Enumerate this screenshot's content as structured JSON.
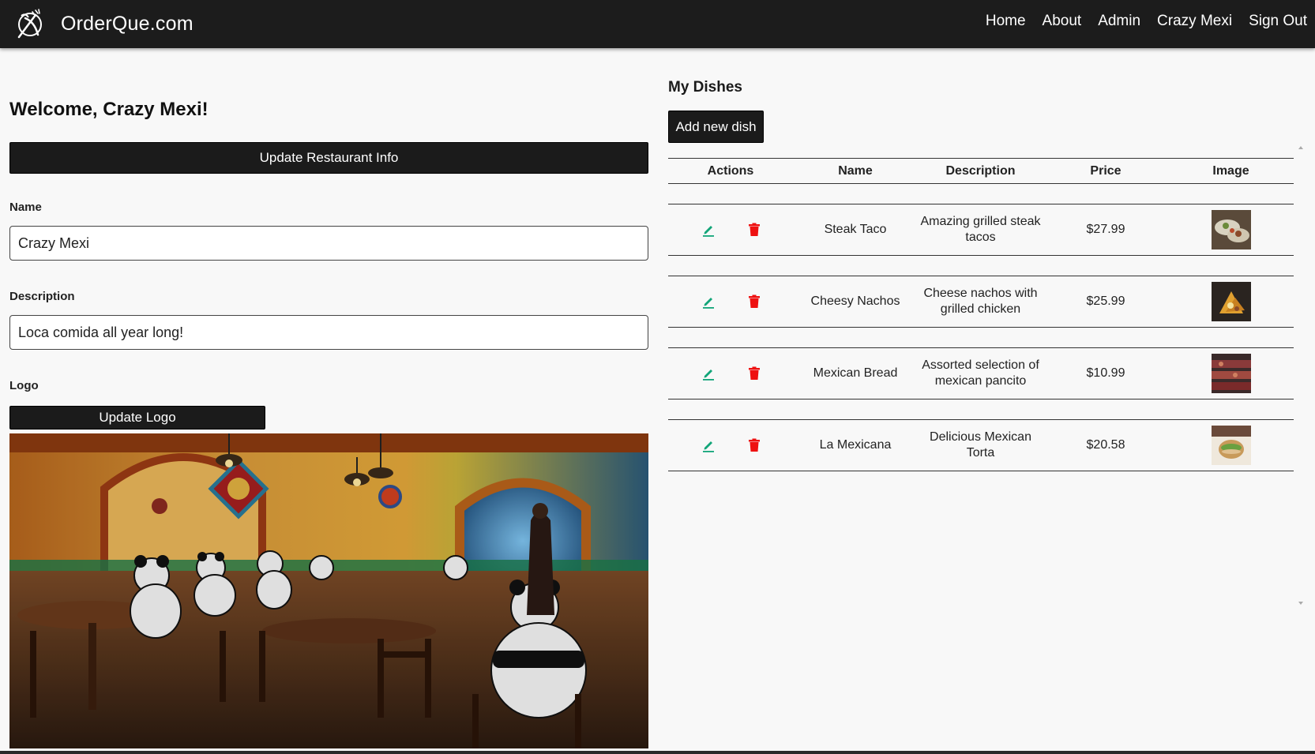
{
  "navbar": {
    "brand": "OrderQue.com",
    "links": [
      "Home",
      "About",
      "Admin",
      "Crazy Mexi",
      "Sign Out"
    ]
  },
  "left": {
    "welcome": "Welcome, Crazy Mexi!",
    "update_info_label": "Update Restaurant Info",
    "name_label": "Name",
    "name_value": "Crazy Mexi",
    "description_label": "Description",
    "description_value": "Loca comida all year long!",
    "logo_label": "Logo",
    "update_logo_label": "Update Logo"
  },
  "right": {
    "title": "My Dishes",
    "add_dish_label": "Add new dish",
    "headers": {
      "actions": "Actions",
      "name": "Name",
      "description": "Description",
      "price": "Price",
      "image": "Image"
    },
    "dishes": [
      {
        "name": "Steak Taco",
        "description": "Amazing grilled steak tacos",
        "price": "$27.99"
      },
      {
        "name": "Cheesy Nachos",
        "description": "Cheese nachos with grilled chicken",
        "price": "$25.99"
      },
      {
        "name": "Mexican Bread",
        "description": "Assorted selection of mexican pancito",
        "price": "$10.99"
      },
      {
        "name": "La Mexicana",
        "description": "Delicious Mexican Torta",
        "price": "$20.58"
      }
    ]
  },
  "icons": {
    "brand": "plate-fork-knife-icon",
    "edit": "pencil-icon",
    "delete": "trash-icon"
  },
  "colors": {
    "navbar": "#1c1c1c",
    "background": "#f8f8f8",
    "button": "#1b1b1b",
    "edit_icon": "#12a579",
    "delete_icon": "#ee1111"
  }
}
